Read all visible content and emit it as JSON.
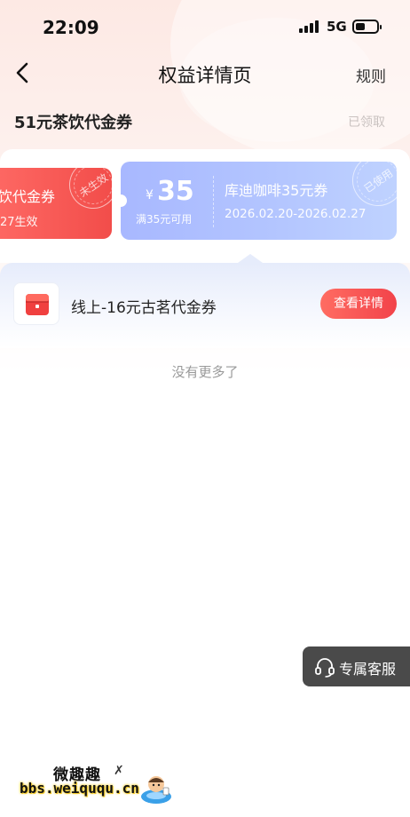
{
  "status_bar": {
    "time": "22:09",
    "network": "5G"
  },
  "nav": {
    "title": "权益详情页",
    "rules": "规则"
  },
  "coupon": {
    "title": "51元茶饮代金券",
    "status": "已领取"
  },
  "cards": [
    {
      "name": "饮代金券",
      "sub": "27生效",
      "stamp": "未生效"
    },
    {
      "currency": "¥",
      "amount": "35",
      "condition": "满35元可用",
      "name": "库迪咖啡35元券",
      "date": "2026.02.20-2026.02.27",
      "stamp": "已使用"
    }
  ],
  "list": [
    {
      "title": "线上-16元古茗代金券",
      "button": "查看详情"
    }
  ],
  "footer": {
    "no_more": "没有更多了"
  },
  "service": {
    "label": "专属客服"
  },
  "watermark": {
    "title": "微趣趣",
    "url": "bbs.weiququ.cn",
    "mark": "✗"
  },
  "colors": {
    "accent_red": "#f24d4a",
    "card_blue": "#a8b8ff",
    "service_bg": "#4a4a4a"
  },
  "icons": {
    "back": "chevron-left-icon",
    "headset": "headset-icon",
    "shop": "shop-icon"
  }
}
